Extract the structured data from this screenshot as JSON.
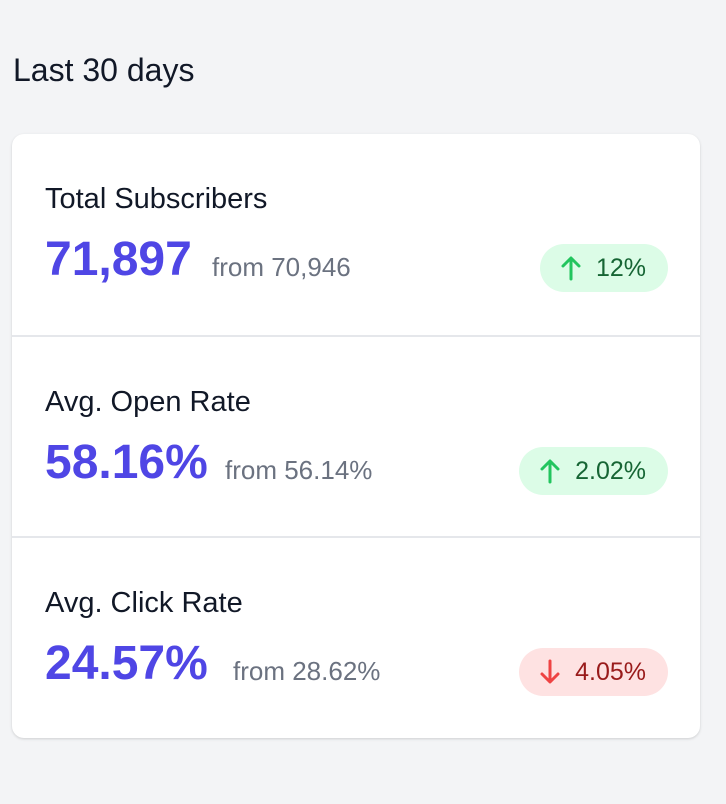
{
  "section_title": "Last 30 days",
  "stats": [
    {
      "label": "Total Subscribers",
      "value": "71,897",
      "from": "from 70,946",
      "change": "12%",
      "direction": "up",
      "icon": "arrow-up-icon"
    },
    {
      "label": "Avg. Open Rate",
      "value": "58.16%",
      "from": "from 56.14%",
      "change": "2.02%",
      "direction": "up",
      "icon": "arrow-up-icon"
    },
    {
      "label": "Avg. Click Rate",
      "value": "24.57%",
      "from": "from 28.62%",
      "change": "4.05%",
      "direction": "down",
      "icon": "arrow-down-icon"
    }
  ],
  "colors": {
    "value": "#4f46e5",
    "up_bg": "#dcfce7",
    "up_text": "#166534",
    "up_icon": "#22c55e",
    "down_bg": "#fee2e2",
    "down_text": "#991b1b",
    "down_icon": "#ef4444"
  }
}
